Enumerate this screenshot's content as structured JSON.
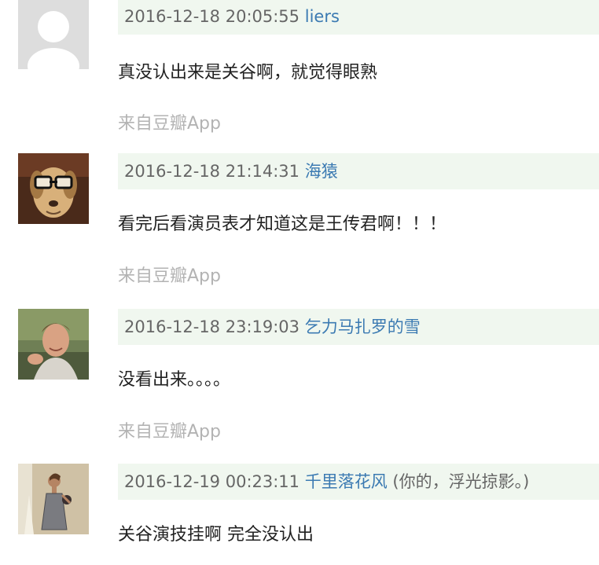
{
  "comments": [
    {
      "time": "2016-12-18 20:05:55",
      "author": "liers",
      "signature": "",
      "text": "真没认出来是关谷啊，就觉得眼熟",
      "source": "来自豆瓣App",
      "avatar": "default-avatar-icon"
    },
    {
      "time": "2016-12-18 21:14:31",
      "author": "海猿",
      "signature": "",
      "text": "看完后看演员表才知道这是王传君啊！！！",
      "source": "来自豆瓣App",
      "avatar": "dog-with-glasses-photo"
    },
    {
      "time": "2016-12-18 23:19:03",
      "author": "乞力马扎罗的雪",
      "signature": "",
      "text": "没看出来。。。。",
      "source": "来自豆瓣App",
      "avatar": "smiling-man-photo"
    },
    {
      "time": "2016-12-19 00:23:11",
      "author": "千里落花风",
      "signature": "(你的，浮光掠影。)",
      "text": "关谷演技挂啊 完全没认出",
      "source": "",
      "avatar": "woman-in-dress-photo"
    }
  ],
  "colors": {
    "header_bg": "#f0f7ef",
    "author_link": "#3b7ab2",
    "meta_text": "#666666",
    "source_text": "#b3b3b3"
  }
}
